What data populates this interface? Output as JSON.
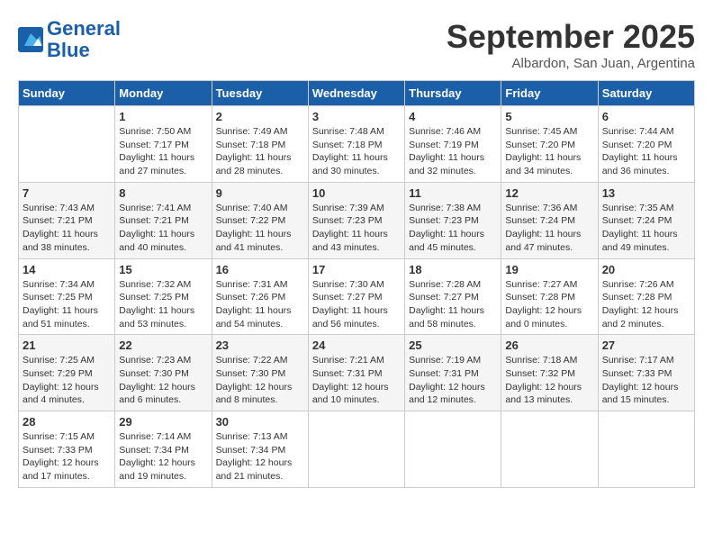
{
  "header": {
    "logo_line1": "General",
    "logo_line2": "Blue",
    "month": "September 2025",
    "location": "Albardon, San Juan, Argentina"
  },
  "weekdays": [
    "Sunday",
    "Monday",
    "Tuesday",
    "Wednesday",
    "Thursday",
    "Friday",
    "Saturday"
  ],
  "weeks": [
    [
      {
        "day": "",
        "sunrise": "",
        "sunset": "",
        "daylight": ""
      },
      {
        "day": "1",
        "sunrise": "Sunrise: 7:50 AM",
        "sunset": "Sunset: 7:17 PM",
        "daylight": "Daylight: 11 hours and 27 minutes."
      },
      {
        "day": "2",
        "sunrise": "Sunrise: 7:49 AM",
        "sunset": "Sunset: 7:18 PM",
        "daylight": "Daylight: 11 hours and 28 minutes."
      },
      {
        "day": "3",
        "sunrise": "Sunrise: 7:48 AM",
        "sunset": "Sunset: 7:18 PM",
        "daylight": "Daylight: 11 hours and 30 minutes."
      },
      {
        "day": "4",
        "sunrise": "Sunrise: 7:46 AM",
        "sunset": "Sunset: 7:19 PM",
        "daylight": "Daylight: 11 hours and 32 minutes."
      },
      {
        "day": "5",
        "sunrise": "Sunrise: 7:45 AM",
        "sunset": "Sunset: 7:20 PM",
        "daylight": "Daylight: 11 hours and 34 minutes."
      },
      {
        "day": "6",
        "sunrise": "Sunrise: 7:44 AM",
        "sunset": "Sunset: 7:20 PM",
        "daylight": "Daylight: 11 hours and 36 minutes."
      }
    ],
    [
      {
        "day": "7",
        "sunrise": "Sunrise: 7:43 AM",
        "sunset": "Sunset: 7:21 PM",
        "daylight": "Daylight: 11 hours and 38 minutes."
      },
      {
        "day": "8",
        "sunrise": "Sunrise: 7:41 AM",
        "sunset": "Sunset: 7:21 PM",
        "daylight": "Daylight: 11 hours and 40 minutes."
      },
      {
        "day": "9",
        "sunrise": "Sunrise: 7:40 AM",
        "sunset": "Sunset: 7:22 PM",
        "daylight": "Daylight: 11 hours and 41 minutes."
      },
      {
        "day": "10",
        "sunrise": "Sunrise: 7:39 AM",
        "sunset": "Sunset: 7:23 PM",
        "daylight": "Daylight: 11 hours and 43 minutes."
      },
      {
        "day": "11",
        "sunrise": "Sunrise: 7:38 AM",
        "sunset": "Sunset: 7:23 PM",
        "daylight": "Daylight: 11 hours and 45 minutes."
      },
      {
        "day": "12",
        "sunrise": "Sunrise: 7:36 AM",
        "sunset": "Sunset: 7:24 PM",
        "daylight": "Daylight: 11 hours and 47 minutes."
      },
      {
        "day": "13",
        "sunrise": "Sunrise: 7:35 AM",
        "sunset": "Sunset: 7:24 PM",
        "daylight": "Daylight: 11 hours and 49 minutes."
      }
    ],
    [
      {
        "day": "14",
        "sunrise": "Sunrise: 7:34 AM",
        "sunset": "Sunset: 7:25 PM",
        "daylight": "Daylight: 11 hours and 51 minutes."
      },
      {
        "day": "15",
        "sunrise": "Sunrise: 7:32 AM",
        "sunset": "Sunset: 7:25 PM",
        "daylight": "Daylight: 11 hours and 53 minutes."
      },
      {
        "day": "16",
        "sunrise": "Sunrise: 7:31 AM",
        "sunset": "Sunset: 7:26 PM",
        "daylight": "Daylight: 11 hours and 54 minutes."
      },
      {
        "day": "17",
        "sunrise": "Sunrise: 7:30 AM",
        "sunset": "Sunset: 7:27 PM",
        "daylight": "Daylight: 11 hours and 56 minutes."
      },
      {
        "day": "18",
        "sunrise": "Sunrise: 7:28 AM",
        "sunset": "Sunset: 7:27 PM",
        "daylight": "Daylight: 11 hours and 58 minutes."
      },
      {
        "day": "19",
        "sunrise": "Sunrise: 7:27 AM",
        "sunset": "Sunset: 7:28 PM",
        "daylight": "Daylight: 12 hours and 0 minutes."
      },
      {
        "day": "20",
        "sunrise": "Sunrise: 7:26 AM",
        "sunset": "Sunset: 7:28 PM",
        "daylight": "Daylight: 12 hours and 2 minutes."
      }
    ],
    [
      {
        "day": "21",
        "sunrise": "Sunrise: 7:25 AM",
        "sunset": "Sunset: 7:29 PM",
        "daylight": "Daylight: 12 hours and 4 minutes."
      },
      {
        "day": "22",
        "sunrise": "Sunrise: 7:23 AM",
        "sunset": "Sunset: 7:30 PM",
        "daylight": "Daylight: 12 hours and 6 minutes."
      },
      {
        "day": "23",
        "sunrise": "Sunrise: 7:22 AM",
        "sunset": "Sunset: 7:30 PM",
        "daylight": "Daylight: 12 hours and 8 minutes."
      },
      {
        "day": "24",
        "sunrise": "Sunrise: 7:21 AM",
        "sunset": "Sunset: 7:31 PM",
        "daylight": "Daylight: 12 hours and 10 minutes."
      },
      {
        "day": "25",
        "sunrise": "Sunrise: 7:19 AM",
        "sunset": "Sunset: 7:31 PM",
        "daylight": "Daylight: 12 hours and 12 minutes."
      },
      {
        "day": "26",
        "sunrise": "Sunrise: 7:18 AM",
        "sunset": "Sunset: 7:32 PM",
        "daylight": "Daylight: 12 hours and 13 minutes."
      },
      {
        "day": "27",
        "sunrise": "Sunrise: 7:17 AM",
        "sunset": "Sunset: 7:33 PM",
        "daylight": "Daylight: 12 hours and 15 minutes."
      }
    ],
    [
      {
        "day": "28",
        "sunrise": "Sunrise: 7:15 AM",
        "sunset": "Sunset: 7:33 PM",
        "daylight": "Daylight: 12 hours and 17 minutes."
      },
      {
        "day": "29",
        "sunrise": "Sunrise: 7:14 AM",
        "sunset": "Sunset: 7:34 PM",
        "daylight": "Daylight: 12 hours and 19 minutes."
      },
      {
        "day": "30",
        "sunrise": "Sunrise: 7:13 AM",
        "sunset": "Sunset: 7:34 PM",
        "daylight": "Daylight: 12 hours and 21 minutes."
      },
      {
        "day": "",
        "sunrise": "",
        "sunset": "",
        "daylight": ""
      },
      {
        "day": "",
        "sunrise": "",
        "sunset": "",
        "daylight": ""
      },
      {
        "day": "",
        "sunrise": "",
        "sunset": "",
        "daylight": ""
      },
      {
        "day": "",
        "sunrise": "",
        "sunset": "",
        "daylight": ""
      }
    ]
  ]
}
